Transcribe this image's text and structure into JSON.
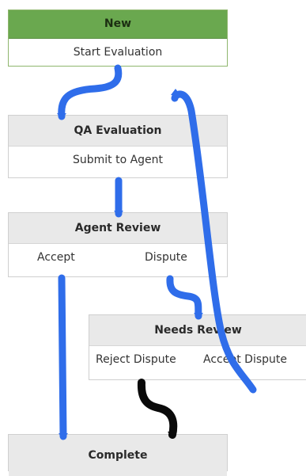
{
  "colors": {
    "connector": "#2f6dea",
    "connector_reject": "#0a0a0a",
    "new_header": "#6aa84f",
    "node_header": "#e9e9e9"
  },
  "nodes": {
    "new": {
      "title": "New",
      "actions": [
        "Start Evaluation"
      ]
    },
    "qa_evaluation": {
      "title": "QA Evaluation",
      "actions": [
        "Submit to Agent"
      ]
    },
    "agent_review": {
      "title": "Agent Review",
      "actions": [
        "Accept",
        "Dispute"
      ]
    },
    "needs_review": {
      "title": "Needs Review",
      "actions": [
        "Reject Dispute",
        "Accept Dispute"
      ]
    },
    "complete": {
      "title": "Complete",
      "actions": []
    }
  }
}
